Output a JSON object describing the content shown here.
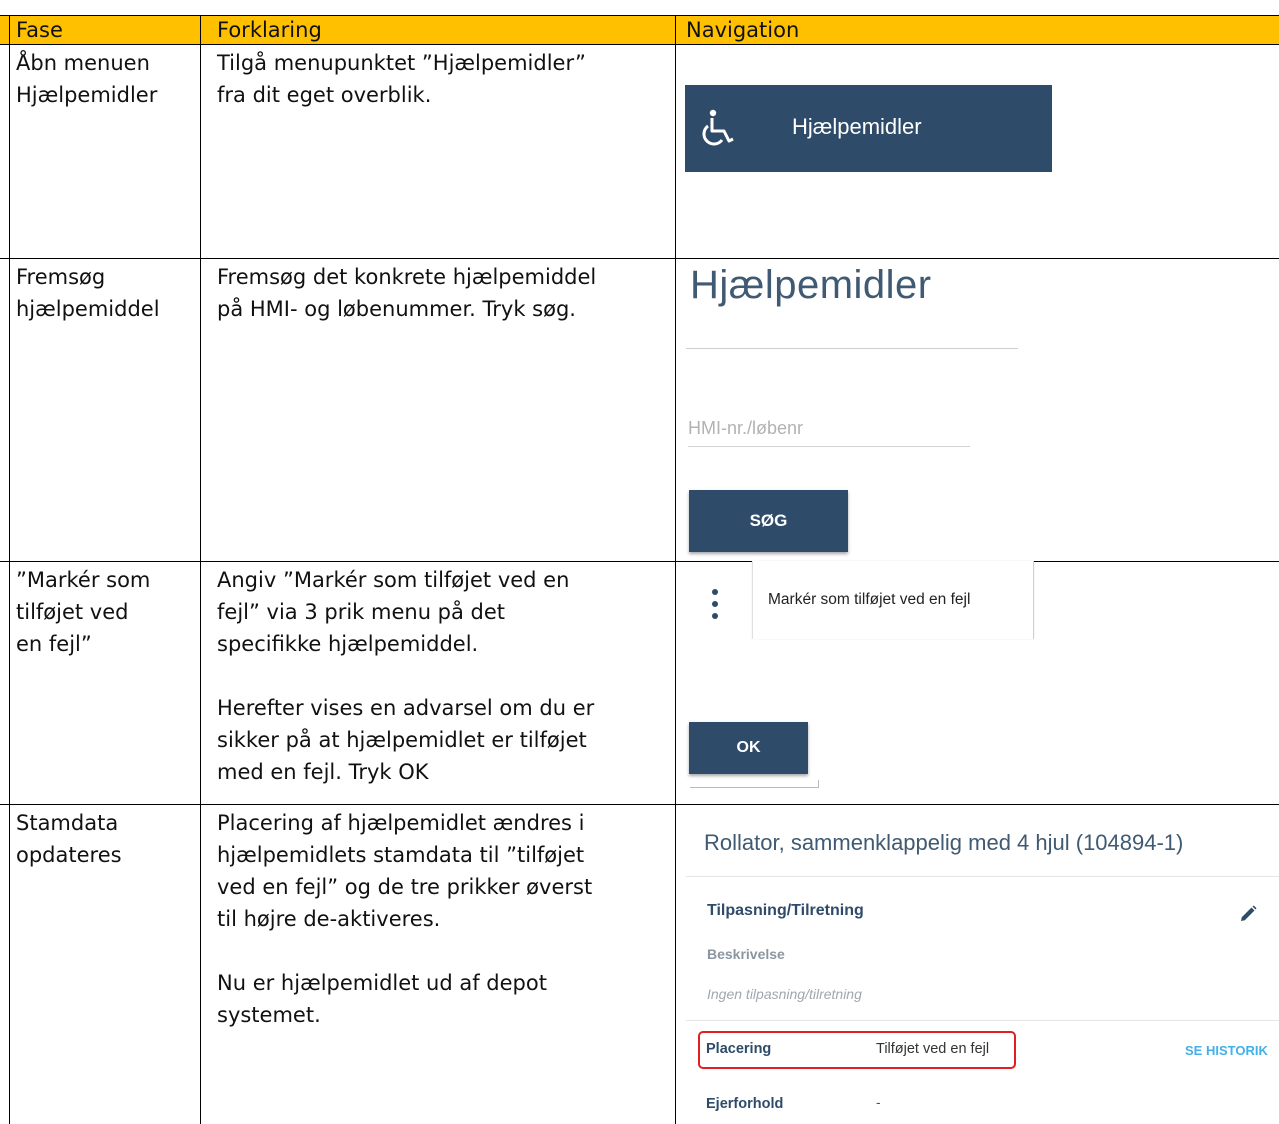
{
  "table": {
    "headers": [
      "Fase",
      "Forklaring",
      "Navigation"
    ],
    "rows": [
      {
        "fase": "Åbn menuen\nHjælpemidler",
        "forklaring": "Tilgå menupunktet ”Hjælpemidler”\nfra dit eget overblik."
      },
      {
        "fase": "Fremsøg\nhjælpemiddel",
        "forklaring": "Fremsøg det konkrete hjælpemiddel\npå HMI- og løbenummer. Tryk søg."
      },
      {
        "fase": "”Markér som\ntilføjet ved\nen fejl”",
        "forklaring": "Angiv  ”Markér som tilføjet ved en\nfejl” via 3 prik menu på det\nspecifikke hjælpemiddel.\n\nHerefter vises en advarsel om du er\nsikker på at hjælpemidlet er tilføjet\nmed en fejl. Tryk OK"
      },
      {
        "fase": "Stamdata\nopdateres",
        "forklaring": "Placering af hjælpemidlet ændres i\nhjælpemidlets stamdata til ”tilføjet\nved en fejl” og de tre prikker øverst\ntil højre de-aktiveres.\n\nNu er hjælpemidlet ud af depot\nsystemet."
      }
    ]
  },
  "nav1": {
    "menu_label": "Hjælpemidler",
    "icon": "wheelchair-icon",
    "bg_color": "#2f4b6a"
  },
  "nav2": {
    "title": "Hjælpemidler",
    "search_placeholder": "HMI-nr./løbenr",
    "search_button": "SØG"
  },
  "nav3": {
    "menu_item": "Markér som tilføjet ved en fejl",
    "ok_button": "OK",
    "menu_icon": "kebab-menu-icon"
  },
  "nav4": {
    "item_title": "Rollator, sammenklappelig med 4 hjul  (104894-1)",
    "section_title": "Tilpasning/Tilretning",
    "description_label": "Beskrivelse",
    "description_value": "Ingen tilpasning/tilretning",
    "placering_label": "Placering",
    "placering_value": "Tilføjet ved en fejl",
    "history_link": "SE HISTORIK",
    "ejerforhold_label": "Ejerforhold",
    "ejerforhold_value": "-",
    "highlight_color": "#e02020"
  }
}
